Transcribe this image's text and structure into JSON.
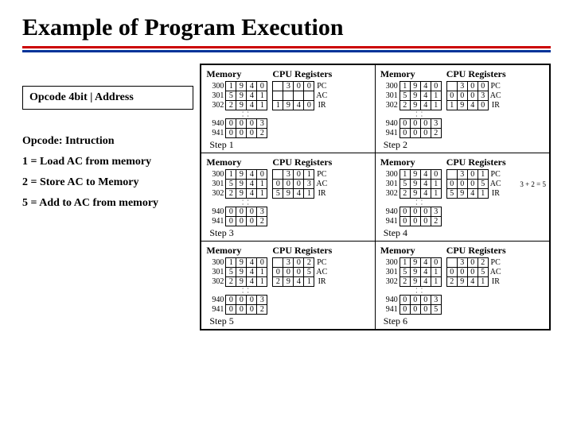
{
  "title": "Example of Program Execution",
  "left": {
    "opcode_box": "Opcode 4bit | Address",
    "section": "Opcode: Intruction",
    "op1": "1 = Load AC from memory",
    "op2": "2 = Store AC to Memory",
    "op5": "5 = Add to AC from memory"
  },
  "labels": {
    "memory": "Memory",
    "cpu": "CPU Registers",
    "pc": "PC",
    "ac": "AC",
    "ir": "IR"
  },
  "steps": [
    {
      "name": "Step 1",
      "mem_top": [
        {
          "addr": "300",
          "cells": [
            "1",
            "9",
            "4",
            "0"
          ]
        },
        {
          "addr": "301",
          "cells": [
            "5",
            "9",
            "4",
            "1"
          ]
        },
        {
          "addr": "302",
          "cells": [
            "2",
            "9",
            "4",
            "1"
          ]
        }
      ],
      "mem_bot": [
        {
          "addr": "940",
          "cells": [
            "0",
            "0",
            "0",
            "3"
          ]
        },
        {
          "addr": "941",
          "cells": [
            "0",
            "0",
            "0",
            "2"
          ]
        }
      ],
      "regs": {
        "pc": [
          "3",
          "0",
          "0"
        ],
        "ac": [
          "",
          "",
          "",
          ""
        ],
        "ir": [
          "1",
          "9",
          "4",
          "0"
        ]
      }
    },
    {
      "name": "Step 2",
      "mem_top": [
        {
          "addr": "300",
          "cells": [
            "1",
            "9",
            "4",
            "0"
          ]
        },
        {
          "addr": "301",
          "cells": [
            "5",
            "9",
            "4",
            "1"
          ]
        },
        {
          "addr": "302",
          "cells": [
            "2",
            "9",
            "4",
            "1"
          ]
        }
      ],
      "mem_bot": [
        {
          "addr": "940",
          "cells": [
            "0",
            "0",
            "0",
            "3"
          ]
        },
        {
          "addr": "941",
          "cells": [
            "0",
            "0",
            "0",
            "2"
          ]
        }
      ],
      "regs": {
        "pc": [
          "3",
          "0",
          "0"
        ],
        "ac": [
          "0",
          "0",
          "0",
          "3"
        ],
        "ir": [
          "1",
          "9",
          "4",
          "0"
        ]
      }
    },
    {
      "name": "Step 3",
      "mem_top": [
        {
          "addr": "300",
          "cells": [
            "1",
            "9",
            "4",
            "0"
          ]
        },
        {
          "addr": "301",
          "cells": [
            "5",
            "9",
            "4",
            "1"
          ]
        },
        {
          "addr": "302",
          "cells": [
            "2",
            "9",
            "4",
            "1"
          ]
        }
      ],
      "mem_bot": [
        {
          "addr": "940",
          "cells": [
            "0",
            "0",
            "0",
            "3"
          ]
        },
        {
          "addr": "941",
          "cells": [
            "0",
            "0",
            "0",
            "2"
          ]
        }
      ],
      "regs": {
        "pc": [
          "3",
          "0",
          "1"
        ],
        "ac": [
          "0",
          "0",
          "0",
          "3"
        ],
        "ir": [
          "5",
          "9",
          "4",
          "1"
        ]
      }
    },
    {
      "name": "Step 4",
      "mem_top": [
        {
          "addr": "300",
          "cells": [
            "1",
            "9",
            "4",
            "0"
          ]
        },
        {
          "addr": "301",
          "cells": [
            "5",
            "9",
            "4",
            "1"
          ]
        },
        {
          "addr": "302",
          "cells": [
            "2",
            "9",
            "4",
            "1"
          ]
        }
      ],
      "mem_bot": [
        {
          "addr": "940",
          "cells": [
            "0",
            "0",
            "0",
            "3"
          ]
        },
        {
          "addr": "941",
          "cells": [
            "0",
            "0",
            "0",
            "2"
          ]
        }
      ],
      "regs": {
        "pc": [
          "3",
          "0",
          "1"
        ],
        "ac": [
          "0",
          "0",
          "0",
          "5"
        ],
        "ir": [
          "5",
          "9",
          "4",
          "1"
        ]
      },
      "annot": "3 + 2 = 5"
    },
    {
      "name": "Step 5",
      "mem_top": [
        {
          "addr": "300",
          "cells": [
            "1",
            "9",
            "4",
            "0"
          ]
        },
        {
          "addr": "301",
          "cells": [
            "5",
            "9",
            "4",
            "1"
          ]
        },
        {
          "addr": "302",
          "cells": [
            "2",
            "9",
            "4",
            "1"
          ]
        }
      ],
      "mem_bot": [
        {
          "addr": "940",
          "cells": [
            "0",
            "0",
            "0",
            "3"
          ]
        },
        {
          "addr": "941",
          "cells": [
            "0",
            "0",
            "0",
            "2"
          ]
        }
      ],
      "regs": {
        "pc": [
          "3",
          "0",
          "2"
        ],
        "ac": [
          "0",
          "0",
          "0",
          "5"
        ],
        "ir": [
          "2",
          "9",
          "4",
          "1"
        ]
      }
    },
    {
      "name": "Step 6",
      "mem_top": [
        {
          "addr": "300",
          "cells": [
            "1",
            "9",
            "4",
            "0"
          ]
        },
        {
          "addr": "301",
          "cells": [
            "5",
            "9",
            "4",
            "1"
          ]
        },
        {
          "addr": "302",
          "cells": [
            "2",
            "9",
            "4",
            "1"
          ]
        }
      ],
      "mem_bot": [
        {
          "addr": "940",
          "cells": [
            "0",
            "0",
            "0",
            "3"
          ]
        },
        {
          "addr": "941",
          "cells": [
            "0",
            "0",
            "0",
            "5"
          ]
        }
      ],
      "regs": {
        "pc": [
          "3",
          "0",
          "2"
        ],
        "ac": [
          "0",
          "0",
          "0",
          "5"
        ],
        "ir": [
          "2",
          "9",
          "4",
          "1"
        ]
      }
    }
  ]
}
